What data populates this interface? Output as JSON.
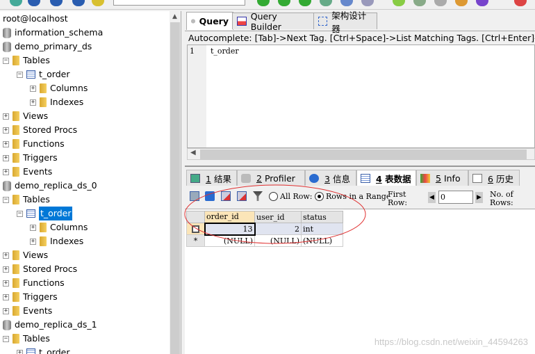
{
  "tree": {
    "root": "root@localhost",
    "items": [
      {
        "label": "information_schema",
        "type": "database",
        "level": 0
      },
      {
        "label": "demo_primary_ds",
        "type": "database",
        "level": 0
      },
      {
        "label": "Tables",
        "type": "folder",
        "level": 1,
        "expanded": true
      },
      {
        "label": "t_order",
        "type": "table",
        "level": 2,
        "expanded": true
      },
      {
        "label": "Columns",
        "type": "folder",
        "level": 3
      },
      {
        "label": "Indexes",
        "type": "folder",
        "level": 3
      },
      {
        "label": "Views",
        "type": "folder",
        "level": 1
      },
      {
        "label": "Stored Procs",
        "type": "folder",
        "level": 1
      },
      {
        "label": "Functions",
        "type": "folder",
        "level": 1
      },
      {
        "label": "Triggers",
        "type": "folder",
        "level": 1
      },
      {
        "label": "Events",
        "type": "folder",
        "level": 1
      },
      {
        "label": "demo_replica_ds_0",
        "type": "database",
        "level": 0
      },
      {
        "label": "Tables",
        "type": "folder",
        "level": 1,
        "expanded": true
      },
      {
        "label": "t_order",
        "type": "table",
        "level": 2,
        "expanded": true,
        "selected": true
      },
      {
        "label": "Columns",
        "type": "folder",
        "level": 3
      },
      {
        "label": "Indexes",
        "type": "folder",
        "level": 3
      },
      {
        "label": "Views",
        "type": "folder",
        "level": 1
      },
      {
        "label": "Stored Procs",
        "type": "folder",
        "level": 1
      },
      {
        "label": "Functions",
        "type": "folder",
        "level": 1
      },
      {
        "label": "Triggers",
        "type": "folder",
        "level": 1
      },
      {
        "label": "Events",
        "type": "folder",
        "level": 1
      },
      {
        "label": "demo_replica_ds_1",
        "type": "database",
        "level": 0
      },
      {
        "label": "Tables",
        "type": "folder",
        "level": 1,
        "expanded": true
      },
      {
        "label": "t_order",
        "type": "table",
        "level": 2
      }
    ]
  },
  "editor_tabs": [
    {
      "label": "Query",
      "active": true
    },
    {
      "label": "Query Builder"
    },
    {
      "label": "架构设计器"
    }
  ],
  "autocomplete": "Autocomplete: [Tab]->Next Tag. [Ctrl+Space]->List Matching Tags. [Ctrl+Enter]->List All Tags.",
  "editor": {
    "line_number": "1",
    "code": "t_order"
  },
  "result_tabs": [
    {
      "num": "1",
      "label": "结果"
    },
    {
      "num": "2",
      "label": "Profiler"
    },
    {
      "num": "3",
      "label": "信息"
    },
    {
      "num": "4",
      "label": "表数据",
      "active": true
    },
    {
      "num": "5",
      "label": "Info"
    },
    {
      "num": "6",
      "label": "历史"
    }
  ],
  "toolbar": {
    "all_rows": "All Row:",
    "rows_in_range": "Rows in a Range",
    "first_row": "First Row:",
    "first_row_value": "0",
    "num_rows": "No. of Rows:"
  },
  "grid": {
    "columns": [
      "order_id",
      "user_id",
      "status"
    ],
    "rows": [
      [
        "13",
        "2",
        "int"
      ]
    ],
    "new_row": [
      "(NULL)",
      "(NULL)",
      "(NULL)"
    ],
    "new_row_marker": "*"
  },
  "watermark": "https://blog.csdn.net/weixin_44594263",
  "colors": {
    "selection": "#0078d7",
    "annotation": "#e03030"
  }
}
